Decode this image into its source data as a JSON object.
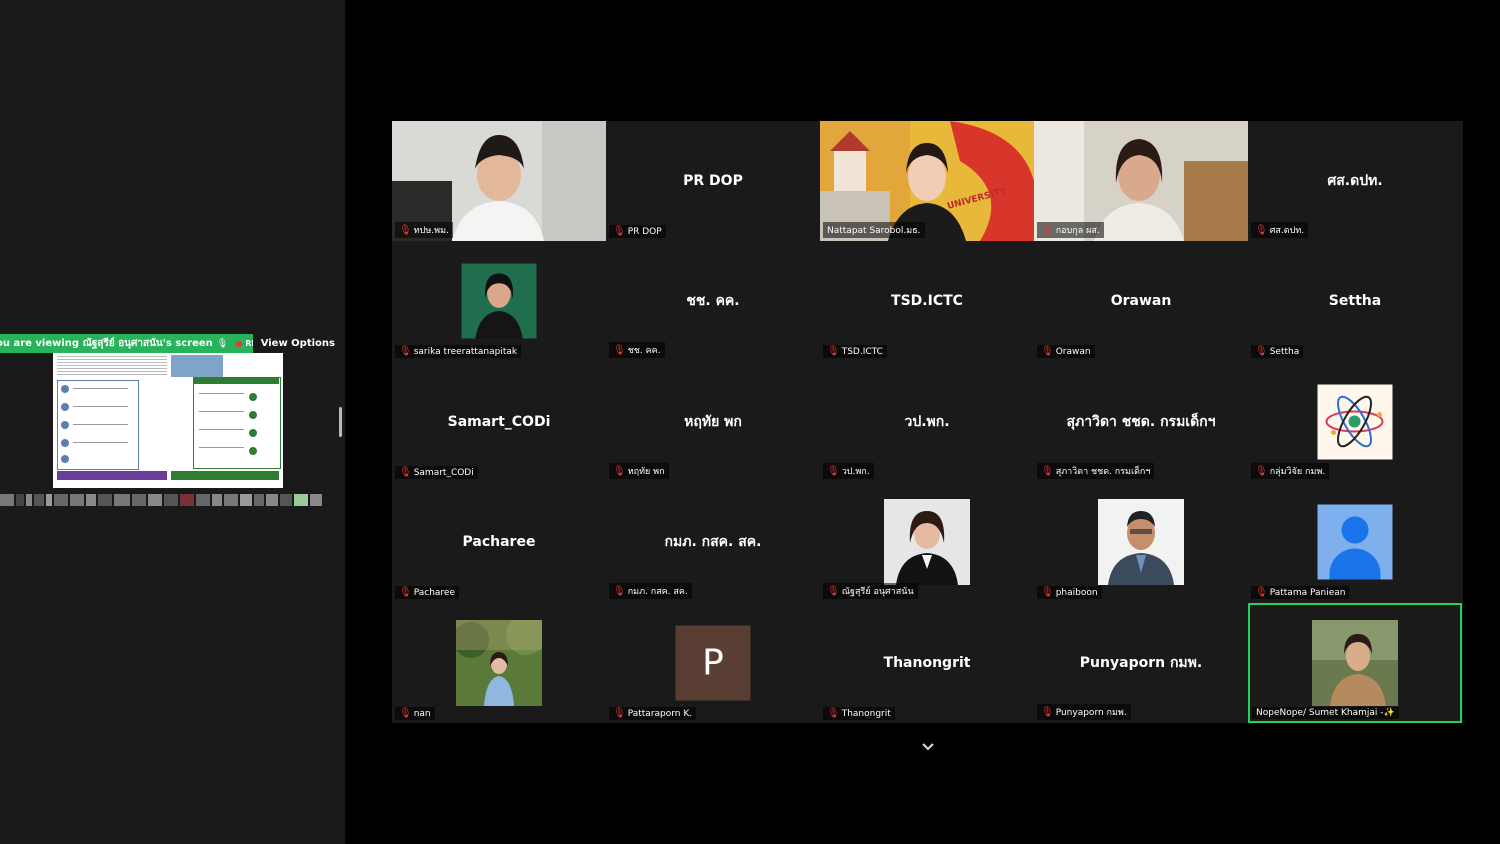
{
  "share": {
    "viewing_text": "ou are viewing  ณัฐสุรีย์ อนุศาสนัน's screen",
    "rec_label": "REC",
    "view_options_label": "View Options"
  },
  "tiles": [
    {
      "name": "ทปษ.พม.",
      "display": "video"
    },
    {
      "name": "PR DOP",
      "display": "name"
    },
    {
      "name": "Nattapat Sarobol.มธ.",
      "display": "video"
    },
    {
      "name": "กอบกุล ผส.",
      "display": "video"
    },
    {
      "name": "ศส.ดปท.",
      "display": "name"
    },
    {
      "name": "sarika treerattanapitak",
      "display": "photo"
    },
    {
      "name": "ชช. คค.",
      "display": "name"
    },
    {
      "name": "TSD.ICTC",
      "display": "name"
    },
    {
      "name": "Orawan",
      "display": "name"
    },
    {
      "name": "Settha",
      "display": "name"
    },
    {
      "name": "Samart_CODi",
      "display": "name"
    },
    {
      "name": "หฤทัย พก",
      "display": "name"
    },
    {
      "name": "วป.พก.",
      "display": "name"
    },
    {
      "name": "สุภาวิดา ชชด. กรมเด็กฯ",
      "display": "name"
    },
    {
      "name": "กลุ่มวิจัย กมพ.",
      "display": "atom"
    },
    {
      "name": "Pacharee",
      "display": "name"
    },
    {
      "name": "กมภ. กสค. สค.",
      "display": "name"
    },
    {
      "name": "ณัฐสุรีย์ อนุศาสนัน",
      "display": "photo"
    },
    {
      "name": "phaiboon",
      "display": "photo"
    },
    {
      "name": "Pattama Paniean",
      "display": "generic"
    },
    {
      "name": "nan",
      "display": "photo"
    },
    {
      "name": "Pattaraporn K.",
      "display": "letter",
      "letter": "P"
    },
    {
      "name": "Thanongrit",
      "display": "name"
    },
    {
      "name": "Punyaporn กมพ.",
      "display": "name"
    },
    {
      "name": "NopeNope/ Sumet Khamjai -✨",
      "display": "photo",
      "active": true
    }
  ],
  "colors": {
    "active_border": "#23d160",
    "share_bar": "#27b35a",
    "tile_bg": "#1a1a1a"
  },
  "icons": {
    "mic_off": "microphone-muted-icon",
    "expand": "chevron-down-icon"
  }
}
